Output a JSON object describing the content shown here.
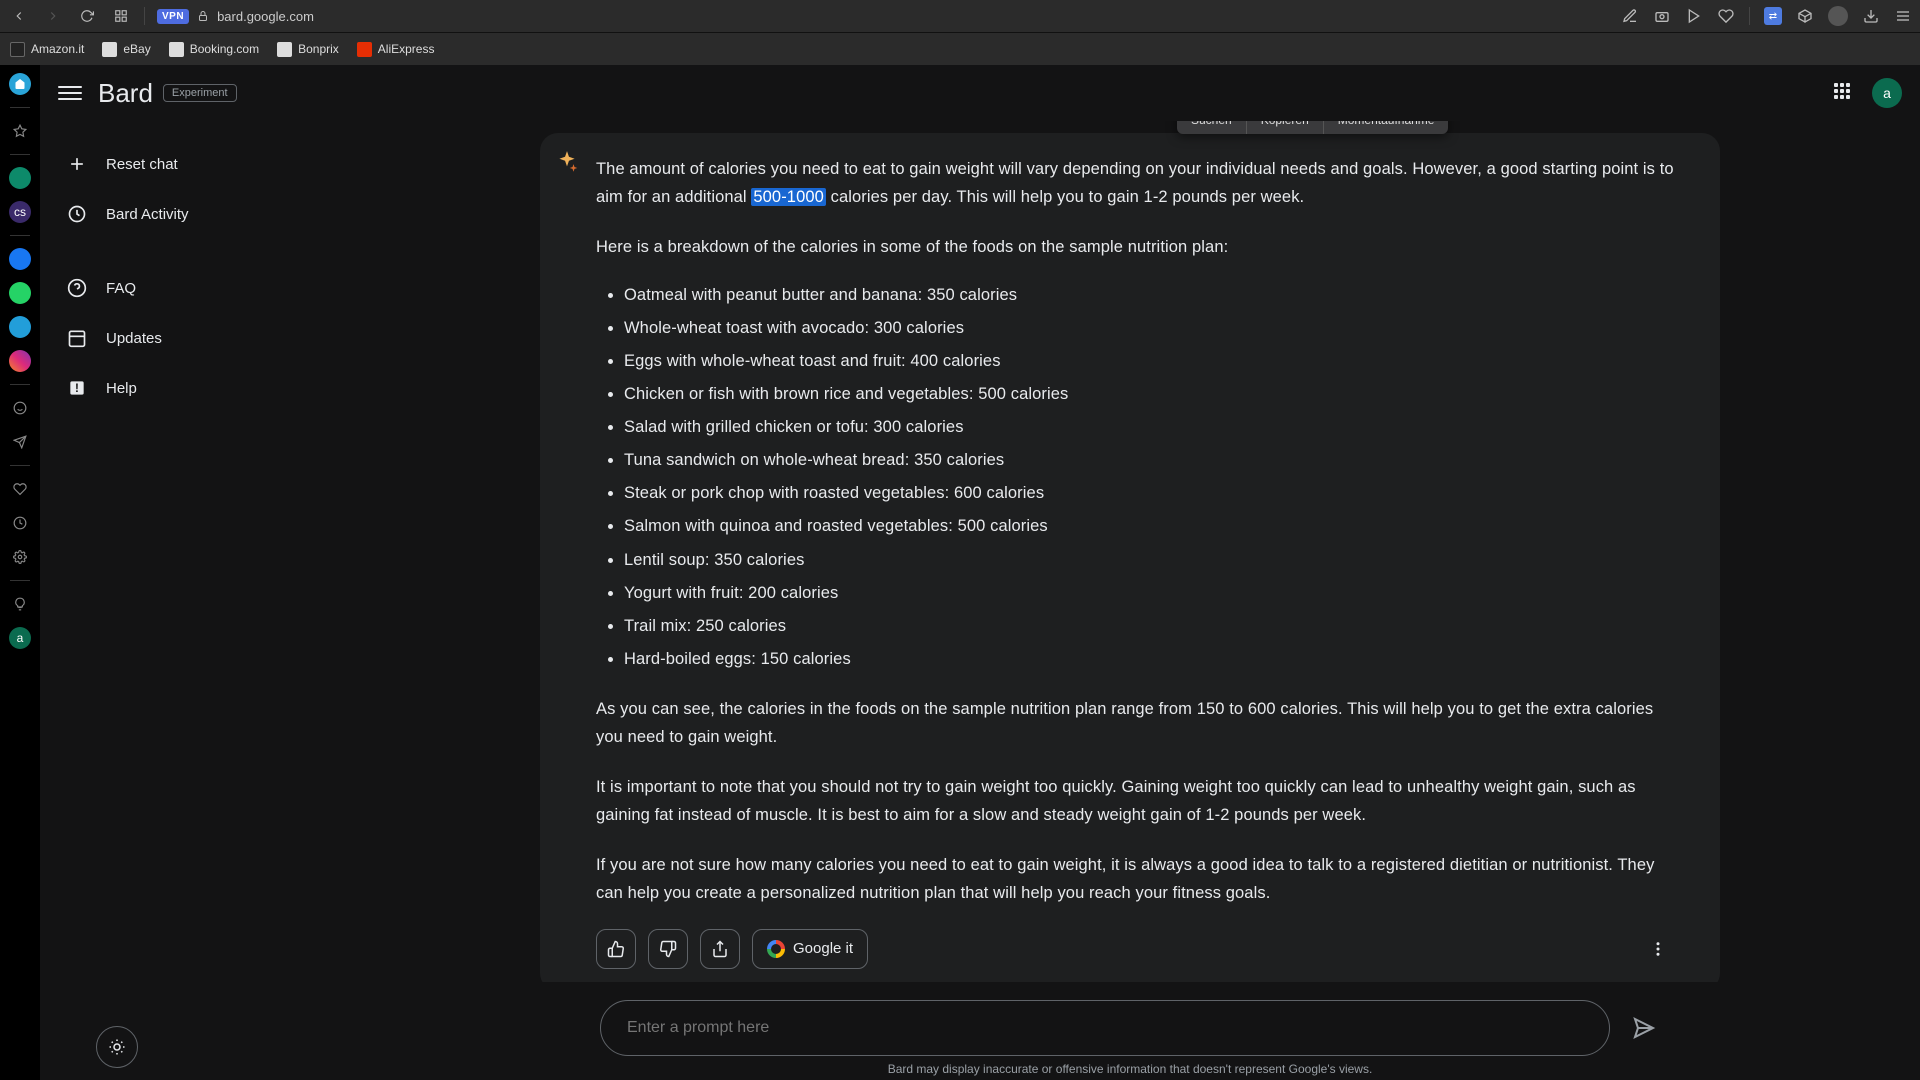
{
  "browser": {
    "url": "bard.google.com",
    "vpn": "VPN"
  },
  "bookmarks": [
    {
      "label": "Amazon.it",
      "color": "#ff9900"
    },
    {
      "label": "eBay",
      "color": "#888"
    },
    {
      "label": "Booking.com",
      "color": "#888"
    },
    {
      "label": "Bonprix",
      "color": "#888"
    },
    {
      "label": "AliExpress",
      "color": "#e62e04"
    }
  ],
  "rail": {
    "avatar_letter": "a"
  },
  "header": {
    "title": "Bard",
    "badge": "Experiment",
    "account_letter": "a"
  },
  "sidebar": {
    "items": [
      {
        "icon": "plus",
        "label": "Reset chat"
      },
      {
        "icon": "clock",
        "label": "Bard Activity"
      },
      {
        "icon": "help",
        "label": "FAQ"
      },
      {
        "icon": "calendar",
        "label": "Updates"
      },
      {
        "icon": "alert",
        "label": "Help"
      }
    ]
  },
  "context_menu": [
    "Suchen",
    "Kopieren",
    "Momentaufnahme"
  ],
  "answer": {
    "intro_before": "The amount of calories you need to eat to gain weight will vary depending on your individual needs and goals. However, a good starting point is to aim for an additional ",
    "highlight": "500-1000",
    "intro_after": " calories per day. This will help you to gain 1-2 pounds per week.",
    "breakdown_intro": "Here is a breakdown of the calories in some of the foods on the sample nutrition plan:",
    "foods": [
      "Oatmeal with peanut butter and banana: 350 calories",
      "Whole-wheat toast with avocado: 300 calories",
      "Eggs with whole-wheat toast and fruit: 400 calories",
      "Chicken or fish with brown rice and vegetables: 500 calories",
      "Salad with grilled chicken or tofu: 300 calories",
      "Tuna sandwich on whole-wheat bread: 350 calories",
      "Steak or pork chop with roasted vegetables: 600 calories",
      "Salmon with quinoa and roasted vegetables: 500 calories",
      "Lentil soup: 350 calories",
      "Yogurt with fruit: 200 calories",
      "Trail mix: 250 calories",
      "Hard-boiled eggs: 150 calories"
    ],
    "p1": "As you can see, the calories in the foods on the sample nutrition plan range from 150 to 600 calories. This will help you to get the extra calories you need to gain weight.",
    "p2": "It is important to note that you should not try to gain weight too quickly. Gaining weight too quickly can lead to unhealthy weight gain, such as gaining fat instead of muscle. It is best to aim for a slow and steady weight gain of 1-2 pounds per week.",
    "p3": "If you are not sure how many calories you need to eat to gain weight, it is always a good idea to talk to a registered dietitian or nutritionist. They can help you create a personalized nutrition plan that will help you reach your fitness goals.",
    "google_it_label": "Google it"
  },
  "composer": {
    "placeholder": "Enter a prompt here"
  },
  "disclaimer": "Bard may display inaccurate or offensive information that doesn't represent Google's views."
}
